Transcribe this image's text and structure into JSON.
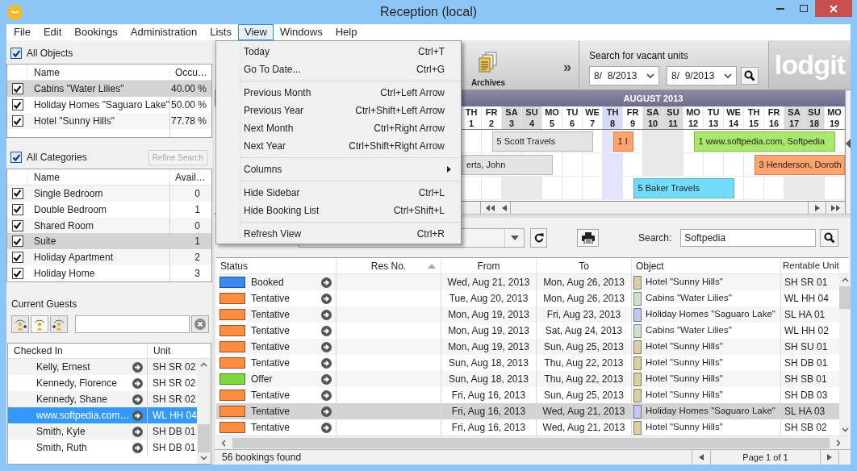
{
  "window": {
    "title": "Reception (local)"
  },
  "menu": [
    {
      "label": "File",
      "selected": false
    },
    {
      "label": "Edit",
      "selected": false
    },
    {
      "label": "Bookings",
      "selected": false
    },
    {
      "label": "Administration",
      "selected": false
    },
    {
      "label": "Lists",
      "selected": false
    },
    {
      "label": "View",
      "selected": true
    },
    {
      "label": "Windows",
      "selected": false
    },
    {
      "label": "Help",
      "selected": false
    }
  ],
  "view_menu": {
    "sections": [
      {
        "items": [
          {
            "kind": "command",
            "label": "Today",
            "shortcut": "Ctrl+T"
          },
          {
            "kind": "command",
            "label": "Go To Date...",
            "shortcut": "Ctrl+G"
          }
        ]
      },
      {
        "items": [
          {
            "kind": "command",
            "label": "Previous Month",
            "shortcut": "Ctrl+Left Arrow"
          },
          {
            "kind": "command",
            "label": "Previous Year",
            "shortcut": "Ctrl+Shift+Left Arrow"
          },
          {
            "kind": "command",
            "label": "Next Month",
            "shortcut": "Ctrl+Right Arrow"
          },
          {
            "kind": "command",
            "label": "Next Year",
            "shortcut": "Ctrl+Shift+Right Arrow"
          }
        ]
      },
      {
        "items": [
          {
            "kind": "submenu",
            "label": "Columns"
          }
        ]
      },
      {
        "items": [
          {
            "kind": "command",
            "label": "Hide Sidebar",
            "shortcut": "Ctrl+L"
          },
          {
            "kind": "command",
            "label": "Hide Booking List",
            "shortcut": "Ctrl+Shift+L"
          }
        ]
      },
      {
        "items": [
          {
            "kind": "command",
            "label": "Refresh View",
            "shortcut": "Ctrl+R"
          }
        ]
      }
    ]
  },
  "sidebar": {
    "objects": {
      "label": "All Objects",
      "checked": true,
      "columns": [
        "Name",
        "Occu…"
      ],
      "rows": [
        {
          "name": "Cabins \"Water Lilies\"",
          "value": "40.00 %",
          "checked": true,
          "selected": true
        },
        {
          "name": "Holiday Homes \"Saguaro Lake\"",
          "value": "50.00 %",
          "checked": true,
          "selected": false
        },
        {
          "name": "Hotel \"Sunny Hills\"",
          "value": "77.78 %",
          "checked": true,
          "selected": false
        }
      ]
    },
    "categories": {
      "label": "All Categories",
      "checked": true,
      "refine_button": {
        "label": "Refine Search",
        "disabled": true
      },
      "columns": [
        "Name",
        "Avail…"
      ],
      "rows": [
        {
          "name": "Single Bedroom",
          "value": "0",
          "checked": true,
          "selected": false
        },
        {
          "name": "Double Bedroom",
          "value": "1",
          "checked": true,
          "selected": false
        },
        {
          "name": "Shared Room",
          "value": "0",
          "checked": true,
          "selected": false
        },
        {
          "name": "Suite",
          "value": "1",
          "checked": true,
          "selected": true
        },
        {
          "name": "Holiday Apartment",
          "value": "2",
          "checked": true,
          "selected": false
        },
        {
          "name": "Holiday Home",
          "value": "3",
          "checked": true,
          "selected": false
        }
      ]
    },
    "guests": {
      "title": "Current Guests",
      "columns": [
        "Checked In",
        "Unit"
      ],
      "rows": [
        {
          "name": "Kelly, Ernest",
          "unit": "SH SR 02",
          "selected": false
        },
        {
          "name": "Kennedy, Florence",
          "unit": "SH SR 02",
          "selected": false
        },
        {
          "name": "Kennedy, Shane",
          "unit": "SH SR 02",
          "selected": false
        },
        {
          "name": "www.softpedia.com…",
          "unit": "WL HH 04",
          "selected": true
        },
        {
          "name": "Smith, Kyle",
          "unit": "SH DB 01",
          "selected": false
        },
        {
          "name": "Smith, Ruth",
          "unit": "SH DB 01",
          "selected": false
        }
      ]
    }
  },
  "toolbar": {
    "archives": "Archives",
    "more": "»",
    "vacant_search": {
      "label": "Search for vacant units",
      "from": "8/  8/2013",
      "to": "8/  9/2013"
    },
    "logo": "lodgit"
  },
  "calendar": {
    "month": "AUGUST 2013",
    "days": [
      {
        "weekday": "TH",
        "date": "1",
        "kind": "weekday"
      },
      {
        "weekday": "FR",
        "date": "2",
        "kind": "weekday"
      },
      {
        "weekday": "SA",
        "date": "3",
        "kind": "weekend"
      },
      {
        "weekday": "SU",
        "date": "4",
        "kind": "weekend"
      },
      {
        "weekday": "MO",
        "date": "5",
        "kind": "weekday"
      },
      {
        "weekday": "TU",
        "date": "6",
        "kind": "weekday"
      },
      {
        "weekday": "WE",
        "date": "7",
        "kind": "weekday"
      },
      {
        "weekday": "TH",
        "date": "8",
        "kind": "today"
      },
      {
        "weekday": "FR",
        "date": "9",
        "kind": "weekday"
      },
      {
        "weekday": "SA",
        "date": "10",
        "kind": "weekend"
      },
      {
        "weekday": "SU",
        "date": "11",
        "kind": "weekend"
      },
      {
        "weekday": "MO",
        "date": "12",
        "kind": "weekday"
      },
      {
        "weekday": "TU",
        "date": "13",
        "kind": "weekday"
      },
      {
        "weekday": "WE",
        "date": "14",
        "kind": "weekday"
      },
      {
        "weekday": "TH",
        "date": "15",
        "kind": "weekday"
      },
      {
        "weekday": "FR",
        "date": "16",
        "kind": "weekday"
      },
      {
        "weekday": "SA",
        "date": "17",
        "kind": "weekend"
      },
      {
        "weekday": "SU",
        "date": "18",
        "kind": "weekend"
      },
      {
        "weekday": "MO",
        "date": "19",
        "kind": "weekday"
      }
    ],
    "lanes": [
      {
        "bookings": [
          {
            "label": "5 Scott Travels",
            "color": "#e4e4e4"
          },
          {
            "label": "1 I",
            "color": "#ffa46c"
          },
          {
            "label": "1 www.softpedia.com, Softpedia",
            "color": "#a9e86a"
          }
        ]
      },
      {
        "bookings": [
          {
            "label": "erts, John",
            "color": "#e4e4e4"
          },
          {
            "label": "3 Henderson, Doroth",
            "color": "#ffa46c"
          }
        ]
      },
      {
        "bookings": [
          {
            "label": "5 Baker Travels",
            "color": "#70dcfa"
          }
        ]
      }
    ]
  },
  "booking_list": {
    "search_label": "Search:",
    "search_value": "Softpedia",
    "columns": [
      "Status",
      "Res No.",
      "From",
      "To",
      "Object",
      "Rentable Unit"
    ],
    "rows": [
      {
        "status": {
          "label": "Booked",
          "color": "#3a8af0"
        },
        "from": "Wed, Aug 21, 2013",
        "to": "Mon, Aug 26, 2013",
        "object": {
          "label": "Hotel \"Sunny Hills\"",
          "color": "#d6cfa8"
        },
        "unit": "SH SR 01",
        "selected": false
      },
      {
        "status": {
          "label": "Tentative",
          "color": "#ff8c42"
        },
        "from": "Tue, Aug 20, 2013",
        "to": "Mon, Aug 26, 2013",
        "object": {
          "label": "Cabins \"Water Lilies\"",
          "color": "#cfe2d2"
        },
        "unit": "WL HH 04",
        "selected": false
      },
      {
        "status": {
          "label": "Tentative",
          "color": "#ff8c42"
        },
        "from": "Mon, Aug 19, 2013",
        "to": "Fri, Aug 23, 2013",
        "object": {
          "label": "Holiday Homes \"Saguaro Lake\"",
          "color": "#c2c8ee"
        },
        "unit": "SL HA 01",
        "selected": false
      },
      {
        "status": {
          "label": "Tentative",
          "color": "#ff8c42"
        },
        "from": "Mon, Aug 19, 2013",
        "to": "Sat, Aug 24, 2013",
        "object": {
          "label": "Cabins \"Water Lilies\"",
          "color": "#cfe2d2"
        },
        "unit": "WL HH 02",
        "selected": false
      },
      {
        "status": {
          "label": "Tentative",
          "color": "#ff8c42"
        },
        "from": "Mon, Aug 19, 2013",
        "to": "Sun, Aug 25, 2013",
        "object": {
          "label": "Hotel \"Sunny Hills\"",
          "color": "#d6cfa8"
        },
        "unit": "SH SU 01",
        "selected": false
      },
      {
        "status": {
          "label": "Tentative",
          "color": "#ff8c42"
        },
        "from": "Sun, Aug 18, 2013",
        "to": "Thu, Aug 22, 2013",
        "object": {
          "label": "Hotel \"Sunny Hills\"",
          "color": "#d6cfa8"
        },
        "unit": "SH DB 01",
        "selected": false
      },
      {
        "status": {
          "label": "Offer",
          "color": "#80d93c"
        },
        "from": "Sun, Aug 18, 2013",
        "to": "Thu, Aug 22, 2013",
        "object": {
          "label": "Hotel \"Sunny Hills\"",
          "color": "#d6cfa8"
        },
        "unit": "SH SB 01",
        "selected": false
      },
      {
        "status": {
          "label": "Tentative",
          "color": "#ff8c42"
        },
        "from": "Fri, Aug 16, 2013",
        "to": "Sun, Aug 25, 2013",
        "object": {
          "label": "Hotel \"Sunny Hills\"",
          "color": "#d6cfa8"
        },
        "unit": "SH DB 03",
        "selected": false
      },
      {
        "status": {
          "label": "Tentative",
          "color": "#ff8c42"
        },
        "from": "Fri, Aug 16, 2013",
        "to": "Wed, Aug 21, 2013",
        "object": {
          "label": "Holiday Homes \"Saguaro Lake\"",
          "color": "#c2c8ee"
        },
        "unit": "SL HA 03",
        "selected": true
      },
      {
        "status": {
          "label": "Tentative",
          "color": "#ff8c42"
        },
        "from": "Fri, Aug 16, 2013",
        "to": "Wed, Aug 21, 2013",
        "object": {
          "label": "Hotel \"Sunny Hills\"",
          "color": "#d6cfa8"
        },
        "unit": "SH SB 02",
        "selected": false
      }
    ],
    "status_text": "56 bookings found",
    "page": "Page 1 of 1"
  }
}
